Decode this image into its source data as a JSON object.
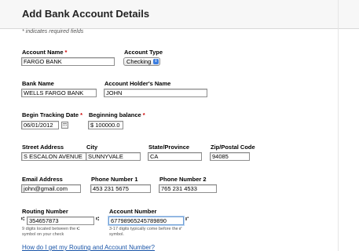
{
  "header": {
    "title": "Add Bank Account Details"
  },
  "note": "* indicates required fields",
  "form": {
    "account_name": {
      "label": "Account Name",
      "required": "*",
      "value": "FARGO BANK"
    },
    "account_type": {
      "label": "Account Type",
      "value": "Checking"
    },
    "bank_name": {
      "label": "Bank Name",
      "value": "WELLS FARGO BANK"
    },
    "holder_name": {
      "label": "Account Holder's Name",
      "value": "JOHN"
    },
    "tracking_date": {
      "label": "Begin Tracking Date",
      "required": "*",
      "value": "06/01/2012"
    },
    "beginning_balance": {
      "label": "Beginning balance",
      "required": "*",
      "currency": "$",
      "value": "100000.0"
    },
    "street": {
      "label": "Street Address",
      "value": "S ESCALON AVENUE"
    },
    "city": {
      "label": "City",
      "value": "SUNNYVALE"
    },
    "state": {
      "label": "State/Province",
      "value": "CA"
    },
    "zip": {
      "label": "Zip/Postal Code",
      "value": "94085"
    },
    "email": {
      "label": "Email Address",
      "value": "john@gmail.com"
    },
    "phone1": {
      "label": "Phone Number 1",
      "value": "453 231 5675"
    },
    "phone2": {
      "label": "Phone Number 2",
      "value": "765 231 4533"
    },
    "routing": {
      "label": "Routing Number",
      "prefix_mark": "⑆",
      "suffix_mark": "⑆",
      "value": "354657873",
      "help": "9 digits located between the ⑆ symbol on your check"
    },
    "account_number": {
      "label": "Account Number",
      "suffix_mark": "⑈",
      "value": "67798965245789890",
      "help": "3-17 digits typically come before the ⑈ symbol."
    }
  },
  "help_link": "How do I get my Routing and Account Number?",
  "colors": {
    "link": "#1a55a8",
    "required": "#cc0000",
    "focus": "#6f9fd6"
  }
}
